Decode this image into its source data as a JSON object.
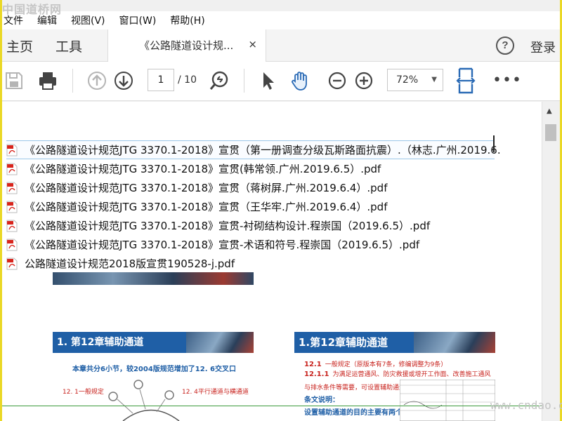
{
  "watermark_top": "中国道桥网",
  "watermark_bottom": "www.cndao.com",
  "menu": [
    "文件",
    "编辑",
    "视图(V)",
    "窗口(W)",
    "帮助(H)"
  ],
  "tabs": {
    "home": "主页",
    "tools": "工具",
    "document": "《公路隧道设计规...",
    "close": "×",
    "help": "?",
    "login": "登录"
  },
  "toolbar": {
    "page_current": "1",
    "page_total": "/ 10",
    "zoom": "72%",
    "more": "•••"
  },
  "files": [
    "《公路隧道设计规范JTG 3370.1-2018》宣贯（第一册调查分级瓦斯路面抗震）.（林志.广州.2019.6.",
    "《公路隧道设计规范JTG 3370.1-2018》宣贯(韩常领.广州.2019.6.5）.pdf",
    "《公路隧道设计规范JTG 3370.1-2018》宣贯（蒋树屏.广州.2019.6.4）.pdf",
    "《公路隧道设计规范JTG 3370.1-2018》宣贯（王华牢.广州.2019.6.4）.pdf",
    "《公路隧道设计规范JTG 3370.1-2018》宣贯-衬砌结构设计.程崇国（2019.6.5）.pdf",
    "《公路隧道设计规范JTG 3370.1-2018》宣贯-术语和符号.程崇国（2019.6.5）.pdf",
    "公路隧道设计规范2018版宣贯190528-j.pdf"
  ],
  "slides": {
    "left": {
      "title": "1. 第12章辅助通道",
      "subtitle": "本章共分6小节，较2004版规范增加了12. 6交叉口",
      "item_left": "12. 1一般规定",
      "item_right": "12. 4平行通道与横通道"
    },
    "right": {
      "title": "1.第12章辅助通道",
      "line1_num": "12.1",
      "line1_text": "一般规定（原版本有7条，修编调整为9条）",
      "line2_num": "12.1.1",
      "line2_text": "为满足运营通风、防灾救援或增开工作面、改善施工通风与排水条件等需要，可设置辅助通道。",
      "note_title": "条文说明：",
      "note_text": "设置辅助通道的目的主要有两个："
    }
  }
}
